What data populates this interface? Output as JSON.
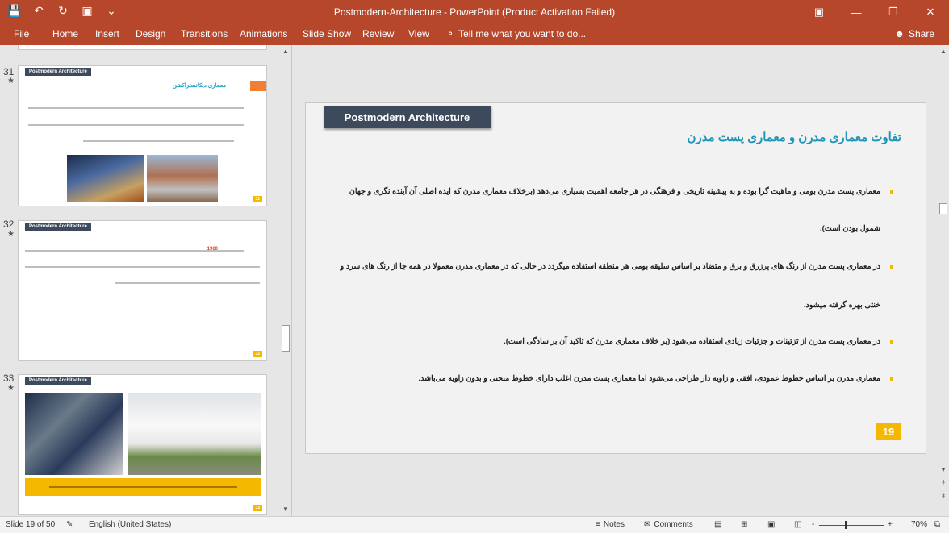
{
  "window": {
    "title": "Postmodern-Architecture - PowerPoint (Product Activation Failed)",
    "qat": {
      "save_icon": "save-icon",
      "undo_icon": "undo-icon",
      "redo_icon": "redo-icon",
      "slideshow_icon": "present-icon",
      "customize_icon": "customize-icon"
    }
  },
  "ribbon": {
    "tabs": [
      "File",
      "Home",
      "Insert",
      "Design",
      "Transitions",
      "Animations",
      "Slide Show",
      "Review",
      "View"
    ],
    "tell_me": "Tell me what you want to do...",
    "share": "Share"
  },
  "thumbnails": [
    {
      "number": "31",
      "star": "★",
      "header": "Postmodern Architecture",
      "title": "معماری دیکانستراکشن",
      "page": "31"
    },
    {
      "number": "32",
      "star": "★",
      "header": "Postmodern Architecture",
      "highlight": "1960",
      "page": "32"
    },
    {
      "number": "33",
      "star": "★",
      "header": "Postmodern Architecture",
      "page": "33"
    }
  ],
  "slide": {
    "header": "Postmodern Architecture",
    "title": "تفاوت معماری مدرن و معماری پست مدرن",
    "bullets": [
      {
        "line1": "معماری پست مدرن بومی و ماهیت گرا بوده و به پیشینه تاریخی و فرهنگی در هر جامعه اهمیت بسیاری می‌دهد (برخلاف معماری مدرن که ایده اصلی آن آینده نگری و جهان",
        "line2": "شمول بودن است)."
      },
      {
        "line1": "در معماری پست مدرن از رنگ های پرزرق و برق و متضاد بر اساس سلیقه بومی هر منطقه استفاده میگردد در حالی که در معماری مدرن معمولا در همه جا از رنگ های سرد و",
        "line2": "خنثی بهره گرفته میشود."
      },
      {
        "line1": "در معماری پست مدرن از تزئینات و جزئیات زیادی استفاده می‌شود (بر خلاف معماری مدرن که تاکید آن بر سادگی است).",
        "line2": ""
      },
      {
        "line1": "معماری مدرن بر اساس خطوط عمودی، افقی و زاویه دار طراحی می‌شود اما معماری پست مدرن اغلب دارای خطوط منحنی و بدون زاویه می‌باشد.",
        "line2": ""
      }
    ],
    "page_number": "19"
  },
  "status": {
    "slide_info": "Slide 19 of 50",
    "language": "English (United States)",
    "notes": "Notes",
    "comments": "Comments",
    "zoom": "70%",
    "zoom_out": "-",
    "zoom_in": "+"
  },
  "colors": {
    "accent": "#b7472a",
    "header_bg": "#3c4a5c",
    "title_blue": "#1f96b8",
    "bullet_yellow": "#f5b800"
  }
}
